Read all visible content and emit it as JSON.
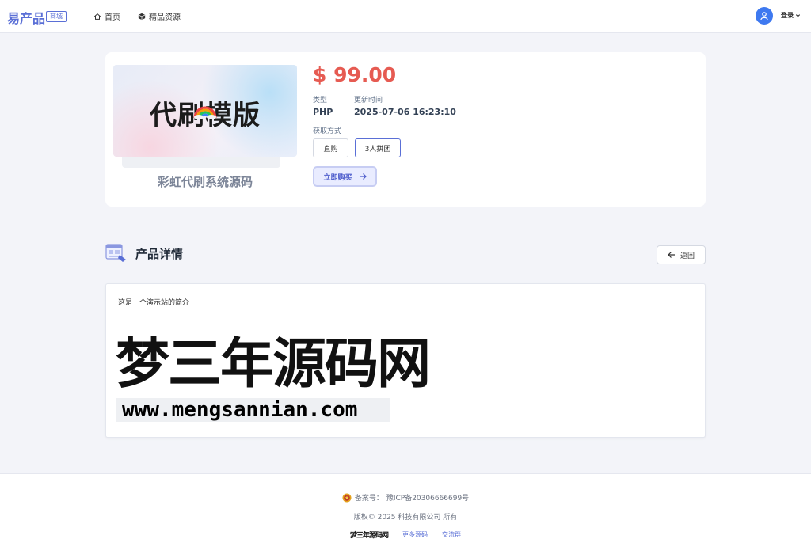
{
  "header": {
    "logo": "易产品",
    "logo_badge": "商城",
    "nav": [
      {
        "label": "首页",
        "icon": "home-icon"
      },
      {
        "label": "精品资源",
        "icon": "cube-icon"
      }
    ],
    "login_label": "登录"
  },
  "product": {
    "thumbnail_text": "代刷模版",
    "name": "彩虹代刷系统源码",
    "price": "$ 99.00",
    "type_label": "类型",
    "type_value": "PHP",
    "updated_label": "更新时间",
    "updated_value": "2025-07-06 16:23:10",
    "acquire_label": "获取方式",
    "options": [
      "直购",
      "3人拼团"
    ],
    "selected_option": "3人拼团",
    "buy_label": "立即购买"
  },
  "details": {
    "title": "产品详情",
    "back_label": "返回",
    "intro": "这是一个演示站的简介",
    "watermark_title": "梦三年源码网",
    "watermark_url": "www.mengsannian.com"
  },
  "footer": {
    "icp_label": "备案号：",
    "icp_value": "豫ICP备20306666699号",
    "copyright": "版权© 2025 科技有限公司 所有",
    "mini_logo": "梦三年源码网",
    "links": [
      "更多源码",
      "交流群"
    ]
  },
  "colors": {
    "accent": "#5a6fd6",
    "price": "#e65b52",
    "background": "#f3f4f9"
  }
}
